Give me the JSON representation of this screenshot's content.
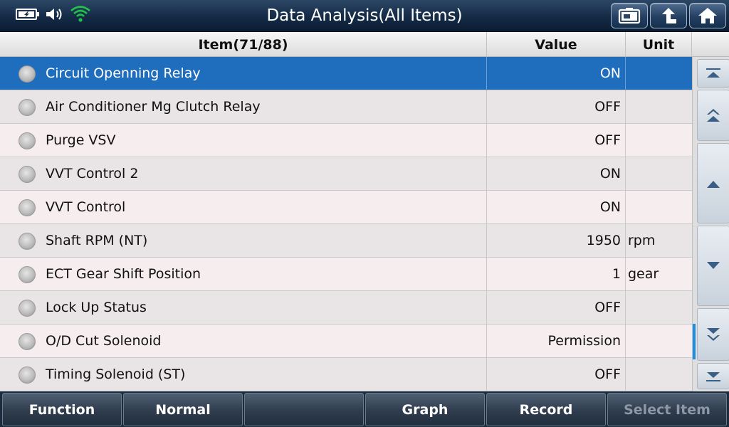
{
  "title": "Data Analysis(All Items)",
  "status_icons": [
    "battery-charging-icon",
    "volume-icon",
    "wifi-icon"
  ],
  "top_buttons": [
    "screenshot-icon",
    "back-icon",
    "home-icon"
  ],
  "table": {
    "headers": {
      "item": "Item(71/88)",
      "value": "Value",
      "unit": "Unit"
    },
    "rows": [
      {
        "label": "Circuit Openning Relay",
        "value": "ON",
        "unit": ""
      },
      {
        "label": "Air Conditioner Mg Clutch Relay",
        "value": "OFF",
        "unit": ""
      },
      {
        "label": "Purge VSV",
        "value": "OFF",
        "unit": ""
      },
      {
        "label": "VVT Control 2",
        "value": "ON",
        "unit": ""
      },
      {
        "label": "VVT Control",
        "value": "ON",
        "unit": ""
      },
      {
        "label": "Shaft RPM (NT)",
        "value": "1950",
        "unit": "rpm"
      },
      {
        "label": "ECT Gear Shift Position",
        "value": "1",
        "unit": "gear"
      },
      {
        "label": "Lock Up Status",
        "value": "OFF",
        "unit": ""
      },
      {
        "label": "O/D Cut Solenoid",
        "value": "Permission",
        "unit": ""
      },
      {
        "label": "Timing Solenoid (ST)",
        "value": "OFF",
        "unit": ""
      }
    ]
  },
  "scroll_buttons": [
    "scroll-top-icon",
    "page-up-icon",
    "line-up-icon",
    "line-down-icon",
    "page-down-icon",
    "scroll-bottom-icon"
  ],
  "toolbar": {
    "function": "Function",
    "normal": "Normal",
    "blank": "",
    "graph": "Graph",
    "record": "Record",
    "select_item": "Select Item"
  },
  "colors": {
    "selected_row": "#1f6dbd",
    "title_bar": "#142a45",
    "scroll_indicator": "#1f8de0"
  }
}
